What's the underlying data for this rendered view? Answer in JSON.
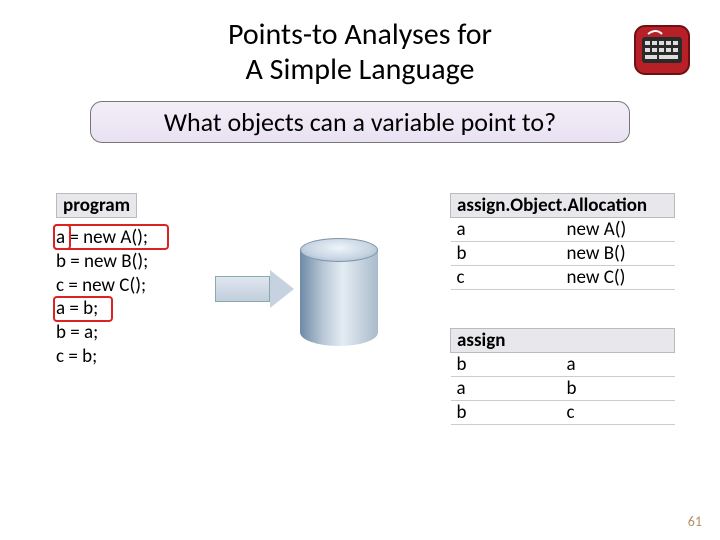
{
  "title_line1": "Points-to Analyses for",
  "title_line2": "A Simple Language",
  "question": "What objects can a variable point to?",
  "program": {
    "label": "program",
    "lines": [
      "a = new A();",
      "b = new B();",
      "c = new C();",
      "a = b;",
      "b = a;",
      "c = b;"
    ]
  },
  "alloc": {
    "header": "assign.Object.Allocation",
    "rows": [
      {
        "v": "a",
        "o": "new A()"
      },
      {
        "v": "b",
        "o": "new B()"
      },
      {
        "v": "c",
        "o": "new C()"
      }
    ]
  },
  "assign": {
    "header": "assign",
    "rows": [
      {
        "l": "b",
        "r": "a"
      },
      {
        "l": "a",
        "r": "b"
      },
      {
        "l": "b",
        "r": "c"
      }
    ]
  },
  "pagenum": "61"
}
